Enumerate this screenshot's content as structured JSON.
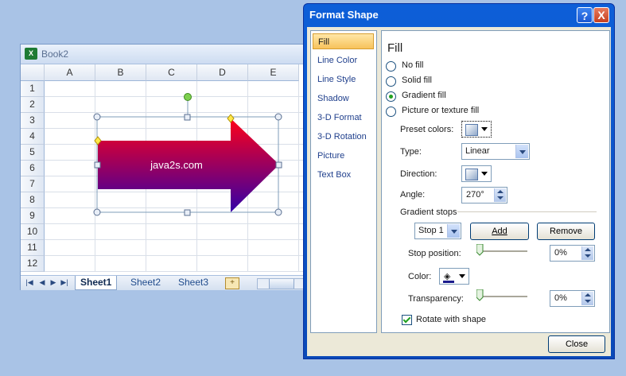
{
  "excel": {
    "title": "Book2",
    "app_icon": "excel-icon",
    "columns": [
      "A",
      "B",
      "C",
      "D",
      "E"
    ],
    "rows": [
      "1",
      "2",
      "3",
      "4",
      "5",
      "6",
      "7",
      "8",
      "9",
      "10",
      "11",
      "12"
    ],
    "shape": {
      "type": "right-arrow",
      "text": "java2s.com",
      "gradient": [
        "#f00020",
        "#3a00a0"
      ]
    },
    "sheet_tabs": [
      "Sheet1",
      "Sheet2",
      "Sheet3"
    ],
    "active_sheet": "Sheet1",
    "nav_icons": [
      "first-sheet-icon",
      "prev-sheet-icon",
      "next-sheet-icon",
      "last-sheet-icon"
    ]
  },
  "dialog": {
    "title": "Format Shape",
    "help": "?",
    "close_x": "X",
    "categories": [
      "Fill",
      "Line Color",
      "Line Style",
      "Shadow",
      "3-D Format",
      "3-D Rotation",
      "Picture",
      "Text Box"
    ],
    "selected_category": "Fill",
    "pane_title": "Fill",
    "fill_options": [
      {
        "label": "No fill",
        "selected": false
      },
      {
        "label": "Solid fill",
        "selected": false
      },
      {
        "label": "Gradient fill",
        "selected": true
      },
      {
        "label": "Picture or texture fill",
        "selected": false
      }
    ],
    "preset_colors_label": "Preset colors:",
    "type_label": "Type:",
    "type_value": "Linear",
    "direction_label": "Direction:",
    "angle_label": "Angle:",
    "angle_value": "270°",
    "gradient_stops_label": "Gradient stops",
    "stop_value": "Stop 1",
    "add_button": "Add",
    "remove_button": "Remove",
    "stop_position_label": "Stop position:",
    "stop_position_value": "0%",
    "color_label": "Color:",
    "transparency_label": "Transparency:",
    "transparency_value": "0%",
    "rotate_label": "Rotate with shape",
    "rotate_checked": true,
    "close_button": "Close"
  }
}
